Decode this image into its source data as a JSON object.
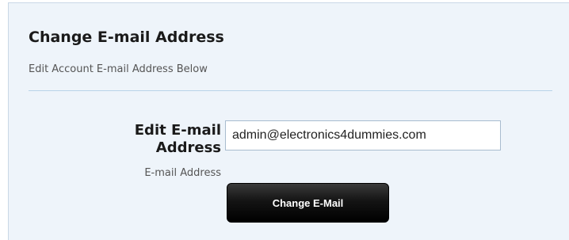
{
  "panel": {
    "title": "Change E-mail Address",
    "subtitle": "Edit Account E-mail Address Below"
  },
  "form": {
    "email_label": "Edit E-mail Address",
    "email_hint": "E-mail Address",
    "email_value": "admin@electronics4dummies.com",
    "submit_label": "Change E-Mail"
  },
  "colors": {
    "panel_background": "#eef4fa",
    "divider": "#b9d3e8",
    "button_background": "#000000",
    "button_text": "#ffffff"
  }
}
